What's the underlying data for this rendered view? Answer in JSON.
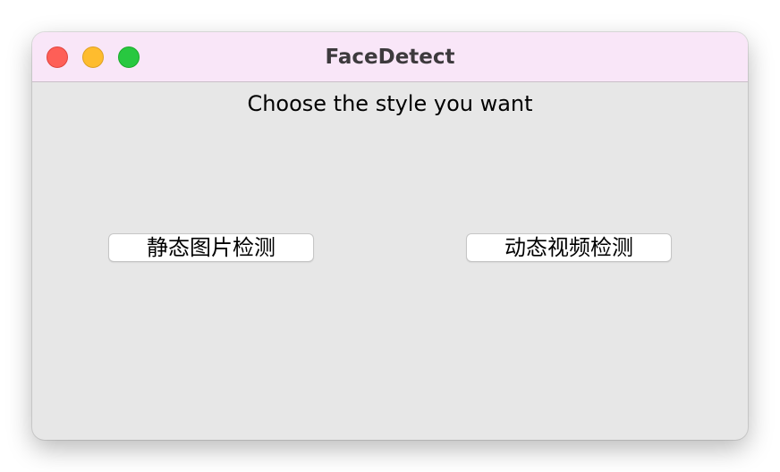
{
  "window": {
    "title": "FaceDetect"
  },
  "main": {
    "prompt": "Choose the style you want",
    "static_button_label": "静态图片检测",
    "dynamic_button_label": "动态视频检测"
  },
  "colors": {
    "titlebar": "#f9e6f8",
    "window_background": "#e7e7e7",
    "close": "#fe5f57",
    "minimize": "#febc2e",
    "zoom": "#28c840"
  }
}
